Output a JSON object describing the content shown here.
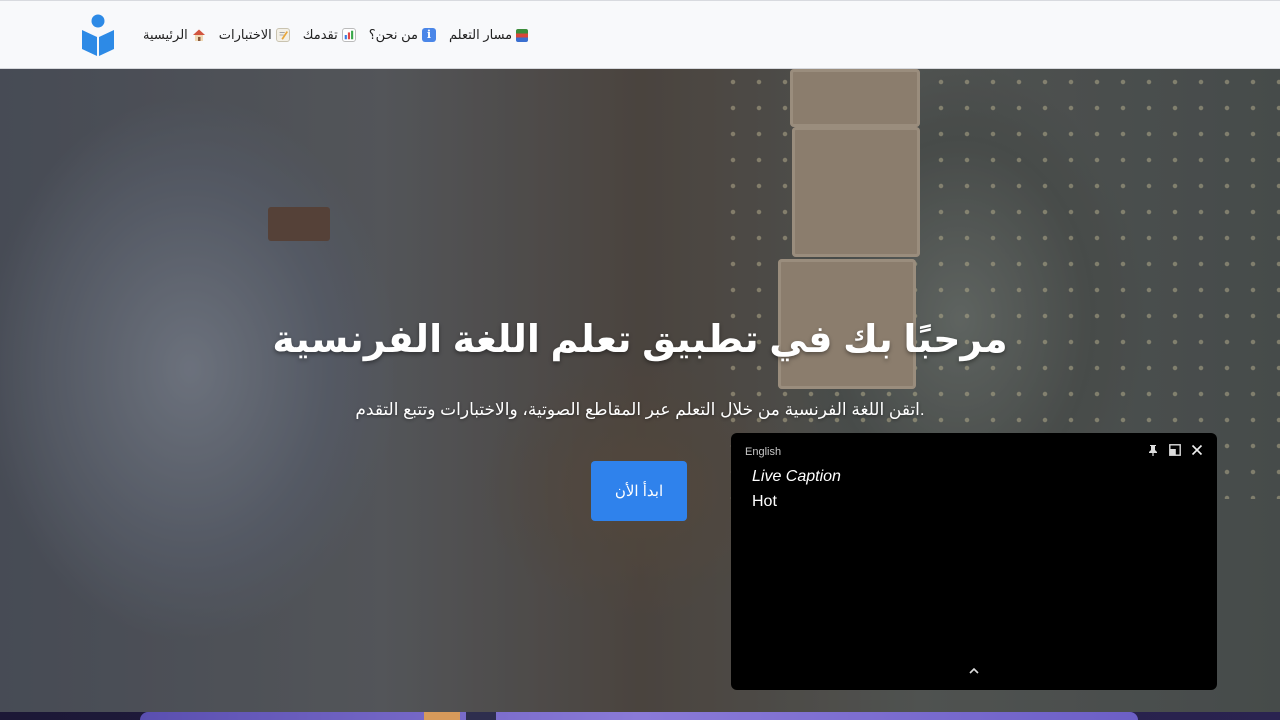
{
  "nav": {
    "items": [
      {
        "label": "مسار التعلم",
        "icon": "books-icon"
      },
      {
        "label": "من نحن؟",
        "icon": "info-icon"
      },
      {
        "label": "تقدمك",
        "icon": "bar-chart-icon"
      },
      {
        "label": "الاختبارات",
        "icon": "memo-icon"
      },
      {
        "label": "الرئيسية",
        "icon": "house-icon"
      }
    ]
  },
  "hero": {
    "title": "مرحبًا بك في تطبيق تعلم اللغة الفرنسية",
    "subtitle": ".اتقن اللغة الفرنسية من خلال التعلم عبر المقاطع الصوتية، والاختبارات وتتبع التقدم",
    "cta_label": "ابدأ الأن"
  },
  "caption": {
    "language": "English",
    "title": "Live Caption",
    "text": "Hot"
  },
  "colors": {
    "accent": "#2f82ec",
    "logo": "#2d8ae6",
    "header_bg": "#f8f9fb",
    "caption_bg": "#000000"
  }
}
